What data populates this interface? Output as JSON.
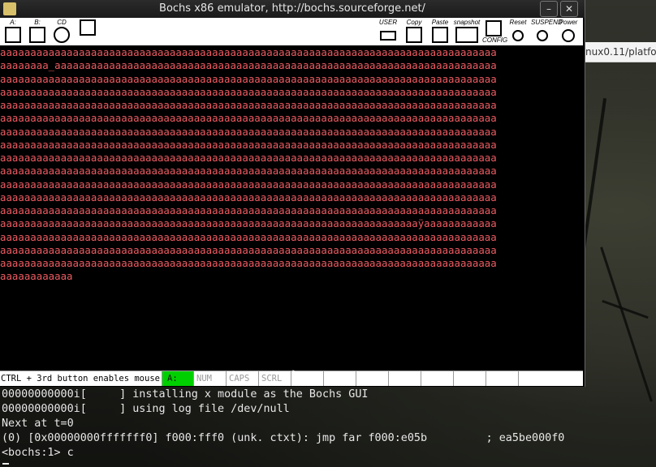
{
  "window": {
    "title": "Bochs x86 emulator, http://bochs.sourceforge.net/",
    "minimize_label": "–",
    "close_label": "✕"
  },
  "browser_peek": {
    "url_text": "nux0.11/platfo"
  },
  "toolbar": {
    "left_tools": [
      {
        "label": "A:",
        "icon": "floppy-a-icon"
      },
      {
        "label": "B:",
        "icon": "floppy-b-icon"
      },
      {
        "label": "CD",
        "icon": "cdrom-icon"
      },
      {
        "label": "",
        "icon": "mouse-capture-icon"
      }
    ],
    "right_tools": [
      {
        "label": "USER",
        "icon": "keyboard-icon"
      },
      {
        "label": "Copy",
        "icon": "copy-icon"
      },
      {
        "label": "Paste",
        "icon": "paste-icon"
      },
      {
        "label": "snapshot",
        "icon": "camera-icon"
      },
      {
        "label": "CONFIG",
        "icon": "config-icon"
      },
      {
        "label": "Reset",
        "icon": "reset-icon"
      },
      {
        "label": "SUSPEND",
        "icon": "suspend-icon"
      },
      {
        "label": "Power",
        "icon": "power-icon"
      }
    ]
  },
  "screen": {
    "lines": [
      "aaaaaaaaaaaaaaaaaaaaaaaaaaaaaaaaaaaaaaaaaaaaaaaaaaaaaaaaaaaaaaaaaaaaaaaaaaaaaaaaaa",
      "aaaaaaaa_aaaaaaaaaaaaaaaaaaaaaaaaaaaaaaaaaaaaaaaaaaaaaaaaaaaaaaaaaaaaaaaaaaaaaaaaa",
      "aaaaaaaaaaaaaaaaaaaaaaaaaaaaaaaaaaaaaaaaaaaaaaaaaaaaaaaaaaaaaaaaaaaaaaaaaaaaaaaaaa",
      "aaaaaaaaaaaaaaaaaaaaaaaaaaaaaaaaaaaaaaaaaaaaaaaaaaaaaaaaaaaaaaaaaaaaaaaaaaaaaaaaaa",
      "aaaaaaaaaaaaaaaaaaaaaaaaaaaaaaaaaaaaaaaaaaaaaaaaaaaaaaaaaaaaaaaaaaaaaaaaaaaaaaaaaa",
      "aaaaaaaaaaaaaaaaaaaaaaaaaaaaaaaaaaaaaaaaaaaaaaaaaaaaaaaaaaaaaaaaaaaaaaaaaaaaaaaaaa",
      "aaaaaaaaaaaaaaaaaaaaaaaaaaaaaaaaaaaaaaaaaaaaaaaaaaaaaaaaaaaaaaaaaaaaaaaaaaaaaaaaaa",
      "aaaaaaaaaaaaaaaaaaaaaaaaaaaaaaaaaaaaaaaaaaaaaaaaaaaaaaaaaaaaaaaaaaaaaaaaaaaaaaaaaa",
      "aaaaaaaaaaaaaaaaaaaaaaaaaaaaaaaaaaaaaaaaaaaaaaaaaaaaaaaaaaaaaaaaaaaaaaaaaaaaaaaaaa",
      "aaaaaaaaaaaaaaaaaaaaaaaaaaaaaaaaaaaaaaaaaaaaaaaaaaaaaaaaaaaaaaaaaaaaaaaaaaaaaaaaaa",
      "aaaaaaaaaaaaaaaaaaaaaaaaaaaaaaaaaaaaaaaaaaaaaaaaaaaaaaaaaaaaaaaaaaaaaaaaaaaaaaaaaa",
      "aaaaaaaaaaaaaaaaaaaaaaaaaaaaaaaaaaaaaaaaaaaaaaaaaaaaaaaaaaaaaaaaaaaaaaaaaaaaaaaaaa",
      "aaaaaaaaaaaaaaaaaaaaaaaaaaaaaaaaaaaaaaaaaaaaaaaaaaaaaaaaaaaaaaaaaaaaaaaaaaaaaaaaaa",
      "aaaaaaaaaaaaaaaaaaaaaaaaaaaaaaaaaaaaaaaaaaaaaaaaaaaaaaaaaaaaaaaaaaaaaÿaaaaaaaaaaaa",
      "aaaaaaaaaaaaaaaaaaaaaaaaaaaaaaaaaaaaaaaaaaaaaaaaaaaaaaaaaaaaaaaaaaaaaaaaaaaaaaaaaa",
      "aaaaaaaaaaaaaaaaaaaaaaaaaaaaaaaaaaaaaaaaaaaaaaaaaaaaaaaaaaaaaaaaaaaaaaaaaaaaaaaaaa",
      "aaaaaaaaaaaaaaaaaaaaaaaaaaaaaaaaaaaaaaaaaaaaaaaaaaaaaaaaaaaaaaaaaaaaaaaaaaaaaaaaaa",
      "aaaaaaaaaaaa"
    ]
  },
  "statusbar": {
    "message": "CTRL + 3rd button enables mouse",
    "drive": "A:",
    "num": "NUM",
    "caps": "CAPS",
    "scrl": "SCRL"
  },
  "console": {
    "lines": [
      "00000000000i[     ] installing x module as the Bochs GUI",
      "00000000000i[     ] using log file /dev/null",
      "Next at t=0",
      "(0) [0x00000000fffffff0] f000:fff0 (unk. ctxt): jmp far f000:e05b         ; ea5be000f0",
      "<bochs:1> c"
    ]
  },
  "colors": {
    "screen_text": "#ec5b62",
    "drive_led": "#00d000"
  }
}
